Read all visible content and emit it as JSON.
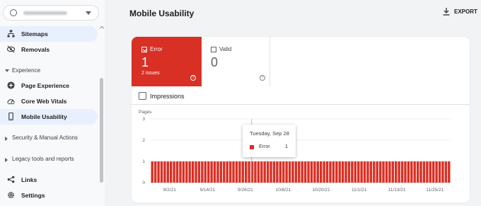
{
  "sidebar": {
    "items": [
      {
        "label": "Sitemaps",
        "icon": "sitemap-icon"
      },
      {
        "label": "Removals",
        "icon": "removals-icon"
      },
      {
        "label": "Page Experience",
        "icon": "page-experience-icon"
      },
      {
        "label": "Core Web Vitals",
        "icon": "speedometer-icon"
      },
      {
        "label": "Mobile Usability",
        "icon": "phone-icon"
      },
      {
        "label": "Links",
        "icon": "links-icon"
      },
      {
        "label": "Settings",
        "icon": "gear-icon"
      }
    ],
    "sections": {
      "experience": "Experience",
      "security": "Security & Manual Actions",
      "legacy": "Legacy tools and reports"
    }
  },
  "header": {
    "title": "Mobile Usability",
    "export_label": "EXPORT"
  },
  "tiles": {
    "error": {
      "label": "Error",
      "count": "1",
      "sub": "2 issues",
      "checked": true,
      "color": "#d93025"
    },
    "valid": {
      "label": "Valid",
      "count": "0",
      "checked": false
    }
  },
  "impressions_label": "Impressions",
  "tooltip": {
    "date": "Tuesday, Sep 28",
    "series": "Error",
    "value": "1"
  },
  "chart_data": {
    "type": "bar",
    "ylabel": "Pages",
    "ylim": [
      0,
      3
    ],
    "yticks": [
      0,
      1,
      2,
      3
    ],
    "bar_color": "#d93025",
    "x_start": "2021-08-27",
    "x_end": "2021-11-30",
    "xtick_labels": [
      "9/2/21",
      "9/14/21",
      "9/26/21",
      "10/8/21",
      "10/20/21",
      "11/1/21",
      "11/13/21",
      "11/25/21"
    ],
    "series": [
      {
        "name": "Error",
        "values": [
          1,
          1,
          1,
          1,
          1,
          1,
          1,
          1,
          1,
          1,
          1,
          1,
          1,
          1,
          1,
          1,
          1,
          1,
          1,
          1,
          1,
          1,
          1,
          1,
          1,
          1,
          1,
          1,
          1,
          1,
          1,
          1,
          1,
          1,
          1,
          1,
          1,
          1,
          1,
          1,
          1,
          1,
          1,
          1,
          1,
          1,
          1,
          1,
          1,
          1,
          1,
          1,
          1,
          1,
          1,
          1,
          1,
          1,
          1,
          1,
          1,
          1,
          1,
          1,
          1,
          1,
          1,
          1,
          1,
          1,
          1,
          1,
          1,
          1,
          1,
          1,
          1,
          1,
          1,
          1,
          1,
          1,
          1,
          1,
          1,
          1,
          1,
          1,
          1,
          1,
          1,
          1,
          1,
          1,
          1,
          1
        ]
      }
    ],
    "highlight_date": "2021-09-28",
    "grid": true
  }
}
